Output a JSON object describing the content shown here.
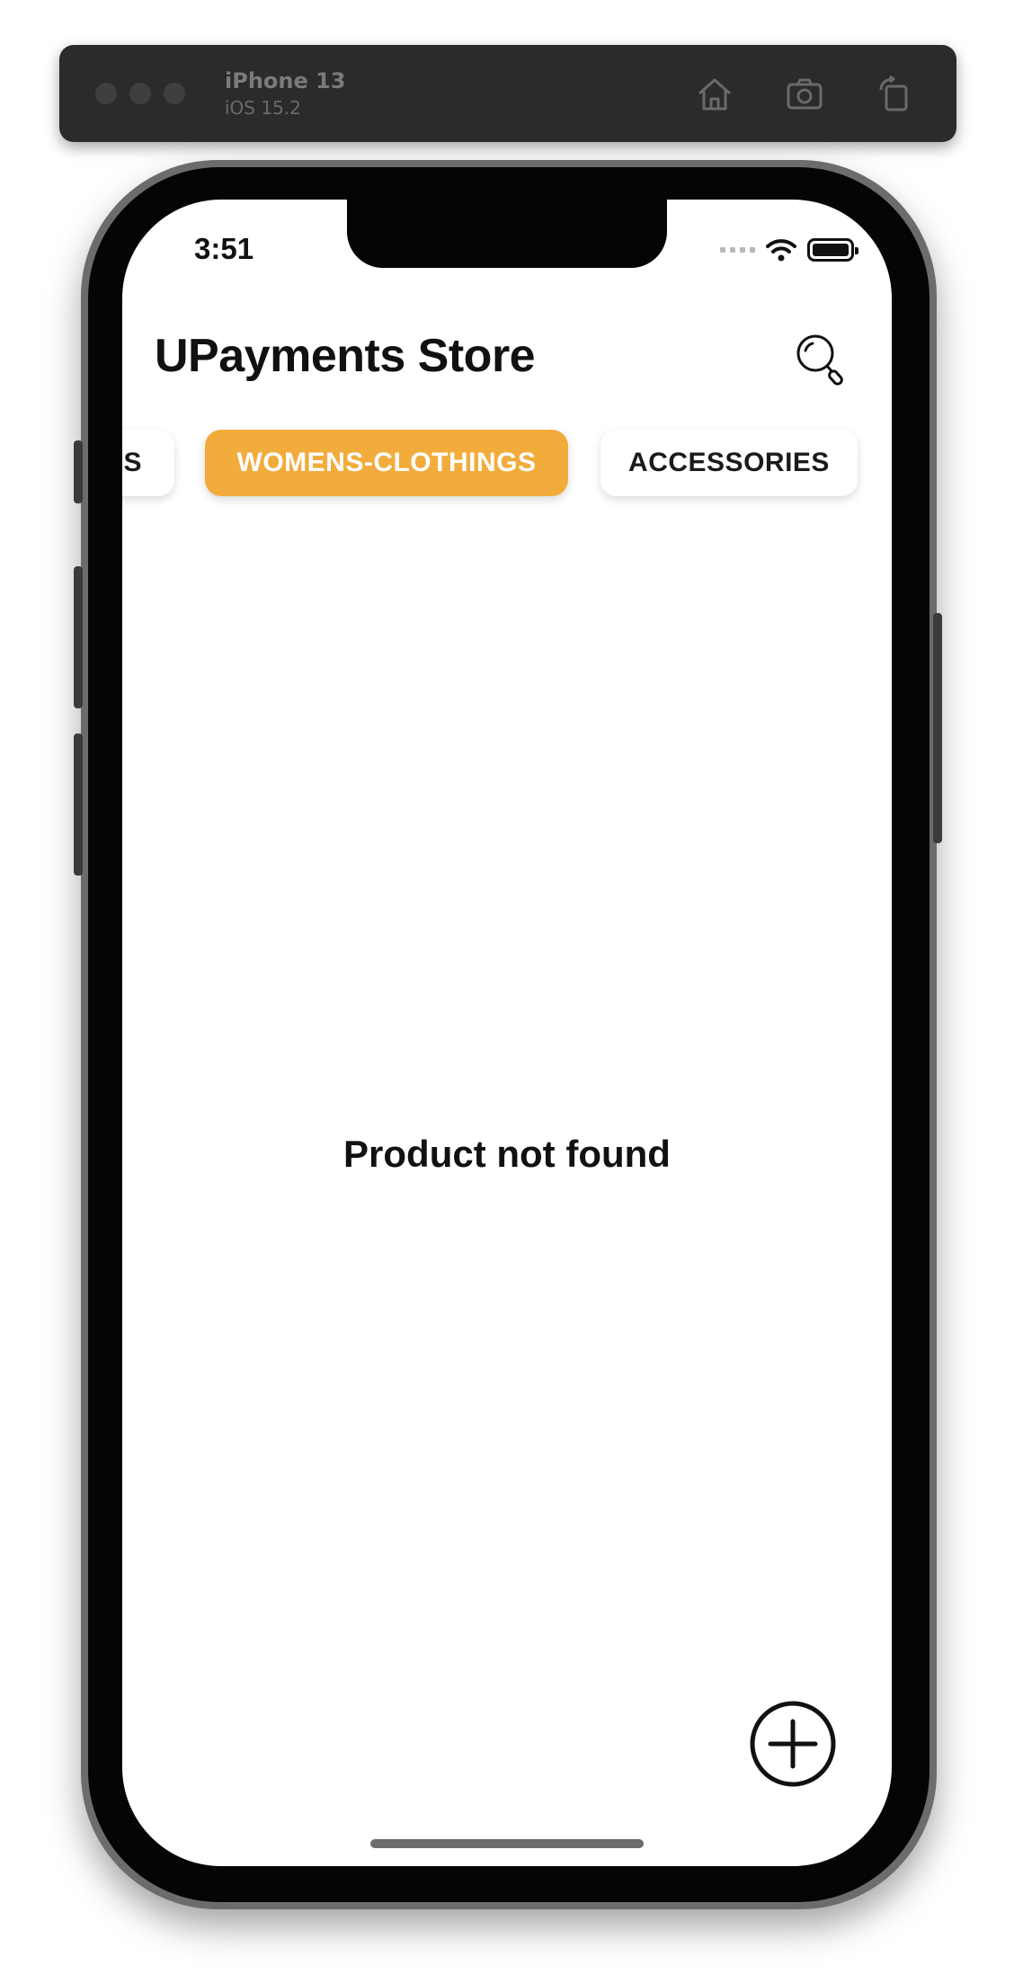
{
  "simulator": {
    "device_name": "iPhone 13",
    "os_version": "iOS 15.2",
    "icons": [
      "home-icon",
      "screenshot-icon",
      "rotate-icon"
    ]
  },
  "status_bar": {
    "time": "3:51"
  },
  "header": {
    "title": "UPayments Store"
  },
  "categories": {
    "items": [
      {
        "label": "ELECTRONICS",
        "visible_text": "S",
        "selected": false
      },
      {
        "label": "WOMENS-CLOTHINGS",
        "selected": true
      },
      {
        "label": "ACCESSORIES",
        "selected": false
      }
    ],
    "selected_color": "#f2ac3c"
  },
  "main": {
    "empty_message": "Product not found"
  }
}
